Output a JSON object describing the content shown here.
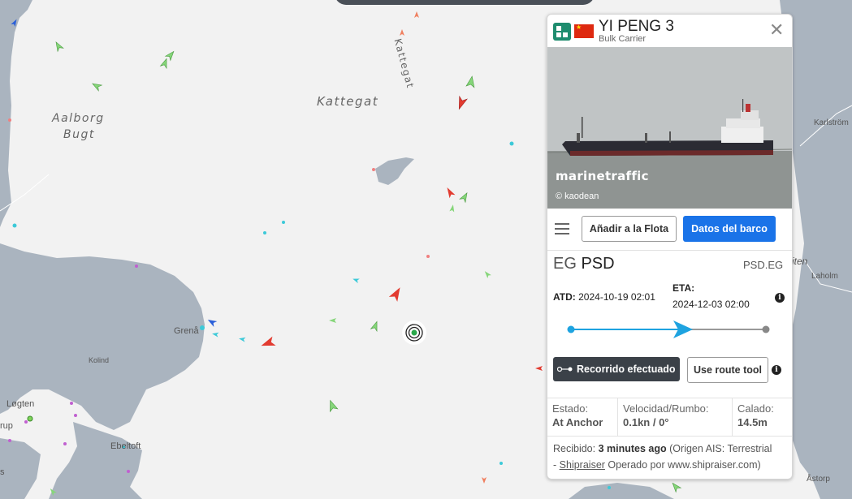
{
  "map": {
    "labels": {
      "sea_main": "Kattegat",
      "sea_vertical": "Kattegat",
      "bay_line1": "Aalborg",
      "bay_line2": "Bugt",
      "grena": "Grenå",
      "kolind": "Kolind",
      "logten": "Løgten",
      "ebeltoft": "Ebeltoft",
      "karlstrom": "Karlström",
      "laholm": "Laholm",
      "astorp": "Åstorp",
      "iten": "iten",
      "rup": "rup",
      "s": "s"
    },
    "colors": {
      "sea": "#f2f2f2",
      "land": "#aab4bf",
      "vessel_cargo": "#86d67a",
      "vessel_tanker": "#e23b30",
      "vessel_passenger": "#2b5fd9",
      "vessel_other": "#3cc9d8"
    }
  },
  "vessel": {
    "name": "YI PENG 3",
    "type": "Bulk Carrier",
    "flag": "China",
    "logo_icon": "marinetraffic-logo-icon",
    "close_icon": "close-icon",
    "photo": {
      "watermark": "marinetraffic",
      "credit": "© kaodean"
    },
    "buttons": {
      "menu_icon": "hamburger-menu-icon",
      "add_to_fleet": "Añadir a la Flota",
      "ship_data": "Datos del barco"
    },
    "route": {
      "from": "EG",
      "to": "PSD",
      "code": "PSD.EG",
      "atd_label": "ATD:",
      "atd_value": "2024-10-19 02:01",
      "eta_label": "ETA:",
      "eta_value": "2024-12-03 02:00",
      "progress": 0.6
    },
    "track_button": "Recorrido efectuado",
    "route_tool_button": "Use route tool",
    "stats": {
      "status_label": "Estado:",
      "status_value": "At Anchor",
      "speed_label": "Velocidad/Rumbo:",
      "speed_value": "0.1kn / 0°",
      "draught_label": "Calado:",
      "draught_value": "14.5m"
    },
    "footer": {
      "received_label": "Recibido:",
      "received_value": "3 minutes ago",
      "source": "(Origen AIS: Terrestrial",
      "dash": "-",
      "provider": "Shipraiser",
      "operated": "Operado por www.shipraiser.com)"
    }
  }
}
